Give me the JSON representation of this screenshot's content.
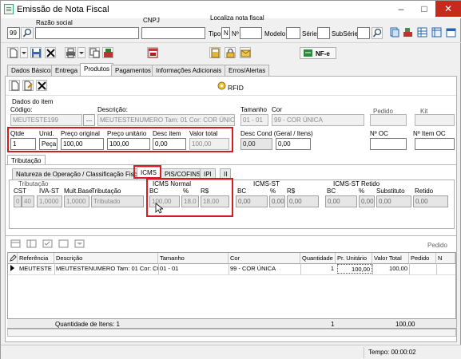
{
  "window": {
    "title": "Emissão de Nota Fiscal",
    "controls": [
      "–",
      "□",
      "✕"
    ]
  },
  "header": {
    "razao_social_label": "Razão social",
    "cnpj_label": "CNPJ",
    "localiza_label": "Localiza nota fiscal",
    "code_value": "99",
    "tipo_label": "Tipo",
    "tipo_value": "N",
    "numero_label": "Nº",
    "modelo_label": "Modelo",
    "serie_label": "Série",
    "subserie_label": "SubSérie"
  },
  "toolbar": {
    "nfe_label": "NF-e"
  },
  "main_tabs": [
    "Dados Básicos",
    "Entrega",
    "Produtos",
    "Pagamentos",
    "Informações Adicionais",
    "Erros/Alertas"
  ],
  "products_toolbar": {
    "rfid_label": "RFID"
  },
  "item": {
    "section_label": "Dados do item",
    "codigo_label": "Código:",
    "codigo_value": "MEUTESTE199",
    "ellipsis": "...",
    "descricao_label": "Descrição:",
    "descricao_value": "MEUTESTENUMERO Tam: 01 Cor: COR ÚNICA",
    "tamanho_label": "Tamanho",
    "tamanho_value": "01 - 01",
    "cor_label": "Cor",
    "cor_value": "99 - COR ÚNICA",
    "pedido_label": "Pedido",
    "kit_label": "Kit",
    "qtde_label": "Qtde",
    "qtde_value": "1",
    "unid_label": "Unid.",
    "unid_value": "Peça",
    "preco_original_label": "Preço original",
    "preco_original_value": "100,00",
    "preco_unitario_label": "Preço unitário",
    "preco_unitario_value": "100,00",
    "desc_item_label": "Desc item",
    "desc_item_value": "0,00",
    "valor_total_label": "Valor total",
    "valor_total_value": "100,00",
    "desc_cond_label": "Desc Cond (Geral / Itens)",
    "desc_cond_geral": "0,00",
    "desc_cond_itens": "0,00",
    "num_oc_label": "Nº OC",
    "num_item_oc_label": "Nº Item OC"
  },
  "tributacao": {
    "section_tab": "Tributação",
    "tabs": [
      "Natureza de Operação / Classificação Fiscal",
      "ICMS",
      "PIS/COFINS",
      "IPI",
      "II"
    ],
    "trib_group": "Tributação",
    "cst_label": "CST",
    "iva_label": "IVA-ST",
    "mult_label": "Mult.Base",
    "trib_label": "Tributação",
    "cst_v1": "0",
    "cst_v2": "40",
    "iva_value": "1,0000",
    "mult_value": "1,0000",
    "trib_value": "Tributado",
    "icms_normal_group": "ICMS Normal",
    "bc_label": "BC",
    "pct_label": "%",
    "rs_label": "R$",
    "icms_bc": "100,00",
    "icms_pct": "18,0",
    "icms_rs": "18,00",
    "icms_st_group": "ICMS-ST",
    "st_bc": "0,00",
    "st_pct": "0,00",
    "st_rs": "0,00",
    "st_retido_group": "ICMS-ST Retido",
    "substituto_label": "Substituto",
    "retido_label": "Retido",
    "ret_bc": "0,00",
    "ret_pct": "0,00",
    "ret_sub": "0,00",
    "ret_ret": "0,00"
  },
  "grid": {
    "pedido_label": "Pedido",
    "columns": [
      "Referência",
      "Descrição",
      "Tamanho",
      "Cor",
      "Quantidade",
      "Pr. Unitário",
      "Valor Total",
      "Pedido",
      "N"
    ],
    "rows": [
      {
        "ref": "MEUTESTE",
        "desc": "MEUTESTENUMERO Tam: 01 Cor: CO",
        "tam": "01 - 01",
        "cor": "99 - COR ÚNICA",
        "qtd": "1",
        "pr": "100,00",
        "total": "100,00"
      }
    ],
    "footer_label": "Quantidade de Itens: 1",
    "footer_qtd": "1",
    "footer_total": "100,00"
  },
  "status": {
    "tempo": "Tempo: 00:00:02"
  },
  "colors": {
    "highlight": "#d41c24",
    "accent": "#1f5fbf"
  }
}
